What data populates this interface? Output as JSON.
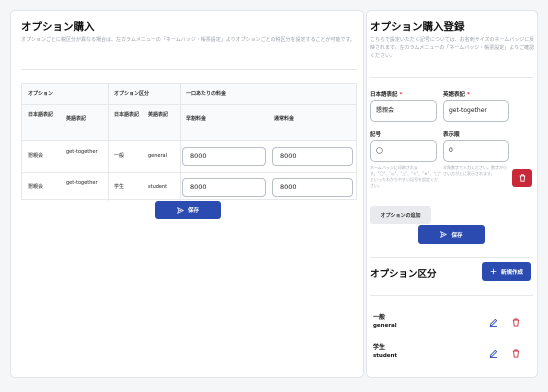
{
  "left": {
    "title": "オプション購入",
    "description": "オプションごとに税区分が異なる場合は、左カラムメニューの「ネームバッジ・帳票設定」よりオプションごとの税区分を設定することが可能です。",
    "table": {
      "group_headers": [
        "オプション",
        "オプション区分",
        "一口あたりの料金"
      ],
      "sub_headers": [
        "日本語表記",
        "英語表記",
        "日本語表記",
        "英語表記",
        "早割料金",
        "通常料金"
      ],
      "rows": [
        {
          "ja": "懇親会",
          "en": "get-together",
          "cat_ja": "一般",
          "cat_en": "general",
          "early": "8000",
          "normal": "8000"
        },
        {
          "ja": "懇親会",
          "en": "get-together",
          "cat_ja": "学生",
          "cat_en": "student",
          "early": "8000",
          "normal": "8000"
        }
      ]
    },
    "save_label": "保存"
  },
  "right": {
    "title": "オプション購入登録",
    "description": "こちらで設定いただく記号については、お名刺サイズのネームバッジに反映されます。左カラムメニューの「ネームバッジ・帳票設定」よりご確認ください。",
    "ja_label": "日本語表記",
    "en_label": "英語表記",
    "required_mark": "*",
    "ja_value": "懇親会",
    "en_value": "get-together",
    "symbol_label": "記号",
    "order_label": "表示順",
    "symbol_value": "◯",
    "order_value": "0",
    "symbol_hint": "ネームバッジに印刷されます。\"〇\"、\"◎\"、\"△\"、\"×\"、\"★\"、\"□\" といったわかりやすい記号を設定ください。",
    "order_hint": "半角数字で入力ください。数字が小さい方が上に表示されます。",
    "add_option_label": "オプションの追加",
    "save_label": "保存",
    "category_title": "オプション区分",
    "new_label": "新規作成",
    "categories": [
      {
        "name": "一般",
        "key": "general"
      },
      {
        "name": "学生",
        "key": "student"
      }
    ]
  },
  "colors": {
    "primary": "#2b4bb0",
    "danger": "#c9283a"
  },
  "icons": [
    "send-icon",
    "trash-icon",
    "plus-icon",
    "pencil-icon"
  ]
}
